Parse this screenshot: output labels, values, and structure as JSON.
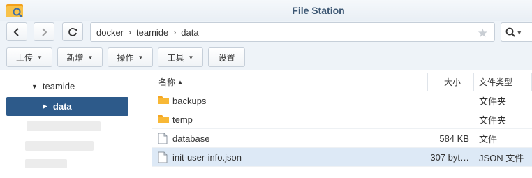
{
  "window": {
    "title": "File Station"
  },
  "navigation": {
    "breadcrumb": [
      "docker",
      "teamide",
      "data"
    ]
  },
  "toolbar": {
    "upload_label": "上传",
    "create_label": "新增",
    "action_label": "操作",
    "tools_label": "工具",
    "settings_label": "设置"
  },
  "tree": {
    "parent_label": "teamide",
    "selected_label": "data"
  },
  "list": {
    "columns": {
      "name": "名称",
      "size": "大小",
      "type": "文件类型"
    },
    "sort": {
      "column": "name",
      "direction": "ascending"
    },
    "rows": [
      {
        "name": "backups",
        "size": "",
        "type": "文件夹",
        "icon": "folder-icon"
      },
      {
        "name": "temp",
        "size": "",
        "type": "文件夹",
        "icon": "folder-icon"
      },
      {
        "name": "database",
        "size": "584 KB",
        "type": "文件",
        "icon": "file-icon"
      },
      {
        "name": "init-user-info.json",
        "size": "307 byt…",
        "type": "JSON 文件",
        "icon": "file-icon",
        "selected": true
      }
    ]
  },
  "colors": {
    "accent": "#2d5a8a",
    "title": "#3e5874",
    "folder": "#f5a623",
    "row_selected": "#dde9f6"
  }
}
